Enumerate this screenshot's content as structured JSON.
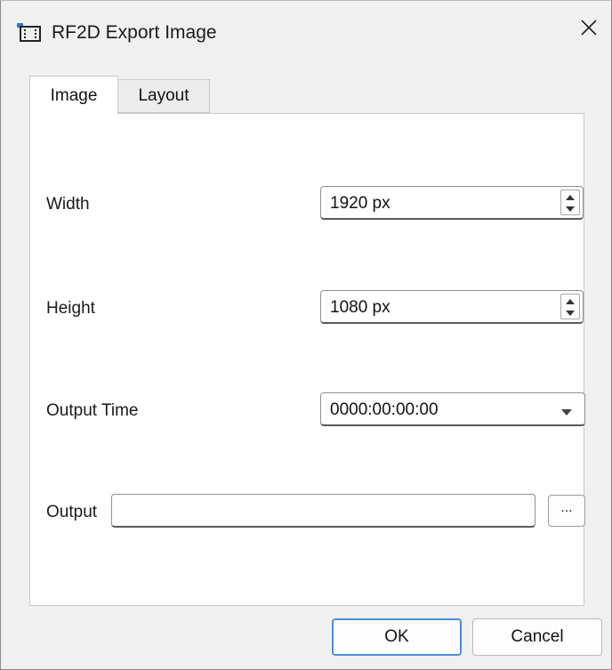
{
  "window": {
    "title": "RF2D Export Image"
  },
  "tabs": [
    {
      "label": "Image",
      "active": true
    },
    {
      "label": "Layout",
      "active": false
    }
  ],
  "form": {
    "width": {
      "label": "Width",
      "value": "1920 px"
    },
    "height": {
      "label": "Height",
      "value": "1080 px"
    },
    "output_time": {
      "label": "Output Time",
      "value": "0000:00:00:00"
    },
    "output": {
      "label": "Output",
      "value": "",
      "browse_label": "..."
    }
  },
  "buttons": {
    "ok": "OK",
    "cancel": "Cancel"
  },
  "icons": {
    "app": "film-export-icon",
    "close": "close-icon"
  },
  "colors": {
    "focus_accent": "#4a8fd9",
    "window_bg": "#f0f0f0",
    "panel_bg": "#ffffff"
  }
}
